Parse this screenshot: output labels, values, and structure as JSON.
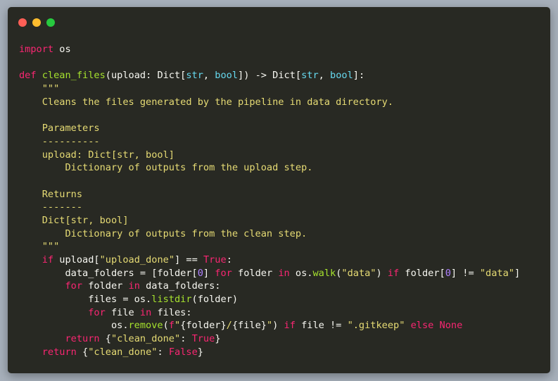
{
  "window": {
    "controls": [
      {
        "name": "close",
        "color": "#ff5f56"
      },
      {
        "name": "minimize",
        "color": "#ffbd2e"
      },
      {
        "name": "maximize",
        "color": "#27c93f"
      }
    ]
  },
  "colors": {
    "background": "#282923",
    "keyword": "#f92672",
    "function": "#a6e22e",
    "builtin": "#66d9ef",
    "string": "#e6db74",
    "number": "#ae81ff",
    "plain": "#f8f8f2"
  },
  "code": {
    "lines": [
      [
        [
          "kw",
          "import"
        ],
        [
          "pl",
          " os"
        ]
      ],
      [],
      [
        [
          "kw",
          "def"
        ],
        [
          "pl",
          " "
        ],
        [
          "fn",
          "clean_files"
        ],
        [
          "pl",
          "(upload: Dict["
        ],
        [
          "bi",
          "str"
        ],
        [
          "pl",
          ", "
        ],
        [
          "bi",
          "bool"
        ],
        [
          "pl",
          "]) -> Dict["
        ],
        [
          "bi",
          "str"
        ],
        [
          "pl",
          ", "
        ],
        [
          "bi",
          "bool"
        ],
        [
          "pl",
          "]:"
        ]
      ],
      [
        [
          "str",
          "    \"\"\""
        ]
      ],
      [
        [
          "str",
          "    Cleans the files generated by the pipeline in data directory."
        ]
      ],
      [],
      [
        [
          "str",
          "    Parameters"
        ]
      ],
      [
        [
          "str",
          "    ----------"
        ]
      ],
      [
        [
          "str",
          "    upload: Dict[str, bool]"
        ]
      ],
      [
        [
          "str",
          "        Dictionary of outputs from the upload step."
        ]
      ],
      [],
      [
        [
          "str",
          "    Returns"
        ]
      ],
      [
        [
          "str",
          "    -------"
        ]
      ],
      [
        [
          "str",
          "    Dict[str, bool]"
        ]
      ],
      [
        [
          "str",
          "        Dictionary of outputs from the clean step."
        ]
      ],
      [
        [
          "str",
          "    \"\"\""
        ]
      ],
      [
        [
          "pl",
          "    "
        ],
        [
          "kw",
          "if"
        ],
        [
          "pl",
          " upload["
        ],
        [
          "str",
          "\"upload_done\""
        ],
        [
          "pl",
          "] == "
        ],
        [
          "kw",
          "True"
        ],
        [
          "pl",
          ":"
        ]
      ],
      [
        [
          "pl",
          "        data_folders = [folder["
        ],
        [
          "num",
          "0"
        ],
        [
          "pl",
          "] "
        ],
        [
          "kw",
          "for"
        ],
        [
          "pl",
          " folder "
        ],
        [
          "kw",
          "in"
        ],
        [
          "pl",
          " os."
        ],
        [
          "fn",
          "walk"
        ],
        [
          "pl",
          "("
        ],
        [
          "str",
          "\"data\""
        ],
        [
          "pl",
          ") "
        ],
        [
          "kw",
          "if"
        ],
        [
          "pl",
          " folder["
        ],
        [
          "num",
          "0"
        ],
        [
          "pl",
          "] != "
        ],
        [
          "str",
          "\"data\""
        ],
        [
          "pl",
          "]"
        ]
      ],
      [
        [
          "pl",
          "        "
        ],
        [
          "kw",
          "for"
        ],
        [
          "pl",
          " folder "
        ],
        [
          "kw",
          "in"
        ],
        [
          "pl",
          " data_folders:"
        ]
      ],
      [
        [
          "pl",
          "            files = os."
        ],
        [
          "fn",
          "listdir"
        ],
        [
          "pl",
          "(folder)"
        ]
      ],
      [
        [
          "pl",
          "            "
        ],
        [
          "kw",
          "for"
        ],
        [
          "pl",
          " file "
        ],
        [
          "kw",
          "in"
        ],
        [
          "pl",
          " files:"
        ]
      ],
      [
        [
          "pl",
          "                os."
        ],
        [
          "fn",
          "remove"
        ],
        [
          "pl",
          "("
        ],
        [
          "kw",
          "f"
        ],
        [
          "str",
          "\""
        ],
        [
          "pl",
          "{folder}"
        ],
        [
          "str",
          "/"
        ],
        [
          "pl",
          "{file}"
        ],
        [
          "str",
          "\""
        ],
        [
          "pl",
          ") "
        ],
        [
          "kw",
          "if"
        ],
        [
          "pl",
          " file != "
        ],
        [
          "str",
          "\".gitkeep\""
        ],
        [
          "pl",
          " "
        ],
        [
          "kw",
          "else"
        ],
        [
          "pl",
          " "
        ],
        [
          "kw",
          "None"
        ]
      ],
      [
        [
          "pl",
          "        "
        ],
        [
          "kw",
          "return"
        ],
        [
          "pl",
          " {"
        ],
        [
          "str",
          "\"clean_done\""
        ],
        [
          "pl",
          ": "
        ],
        [
          "kw",
          "True"
        ],
        [
          "pl",
          "}"
        ]
      ],
      [
        [
          "pl",
          "    "
        ],
        [
          "kw",
          "return"
        ],
        [
          "pl",
          " {"
        ],
        [
          "str",
          "\"clean_done\""
        ],
        [
          "pl",
          ": "
        ],
        [
          "kw",
          "False"
        ],
        [
          "pl",
          "}"
        ]
      ]
    ]
  }
}
